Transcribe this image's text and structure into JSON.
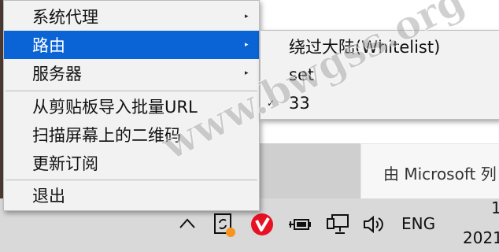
{
  "menu": {
    "items": [
      {
        "label": "系统代理",
        "has_submenu": true
      },
      {
        "label": "路由",
        "has_submenu": true,
        "selected": true
      },
      {
        "label": "服务器",
        "has_submenu": true
      },
      {
        "label": "从剪贴板导入批量URL"
      },
      {
        "label": "扫描屏幕上的二维码"
      },
      {
        "label": "更新订阅"
      },
      {
        "label": "退出"
      }
    ],
    "arrow_glyph": "▸"
  },
  "submenu": {
    "items": [
      {
        "label": "绕过大陆(Whitelist)",
        "checked": false
      },
      {
        "label": "set",
        "checked": false
      },
      {
        "label": "33",
        "checked": true
      }
    ],
    "check_glyph": "✓"
  },
  "background": {
    "notification_text": "由 Microsoft 列"
  },
  "taskbar": {
    "language": "ENG",
    "time": "1",
    "date": "2021"
  },
  "watermark": "www.bwgss.org",
  "colors": {
    "selection": "#0a64d6",
    "menu_bg": "#f2f2f2",
    "taskbar_bg": "#d9d9d9",
    "red_icon": "#e81123",
    "badge_orange": "#f7941d"
  },
  "icons": [
    "chevron-up-icon",
    "sync-app-icon",
    "red-v-app-icon",
    "battery-plug-icon",
    "network-icon",
    "volume-icon"
  ]
}
